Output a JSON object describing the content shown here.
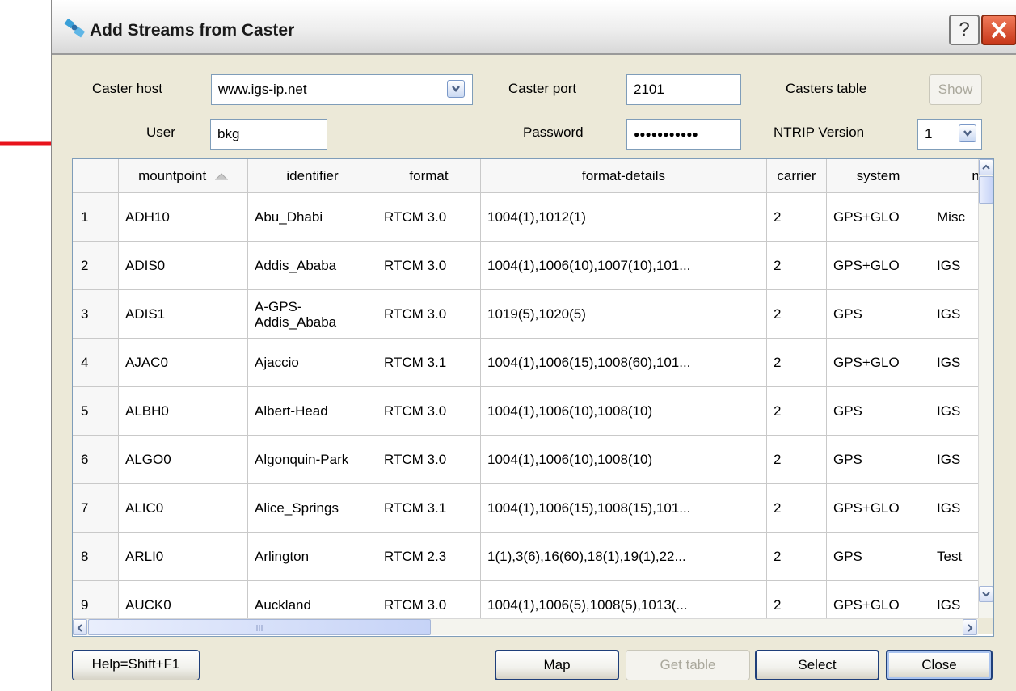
{
  "window": {
    "title": "Add Streams from Caster",
    "help_glyph": "?",
    "close_glyph": "✕"
  },
  "form": {
    "caster_host_label": "Caster host",
    "caster_host_value": "www.igs-ip.net",
    "caster_port_label": "Caster port",
    "caster_port_value": "2101",
    "casters_table_label": "Casters table",
    "show_label": "Show",
    "user_label": "User",
    "user_value": "bkg",
    "password_label": "Password",
    "password_value": "●●●●●●●●●●●",
    "ntrip_label": "NTRIP Version",
    "ntrip_value": "1"
  },
  "table": {
    "columns": [
      "",
      "mountpoint",
      "identifier",
      "format",
      "format-details",
      "carrier",
      "system",
      "net"
    ],
    "rows": [
      [
        "1",
        "ADH10",
        "Abu_Dhabi",
        "RTCM 3.0",
        "1004(1),1012(1)",
        "2",
        "GPS+GLO",
        "Misc"
      ],
      [
        "2",
        "ADIS0",
        "Addis_Ababa",
        "RTCM 3.0",
        "1004(1),1006(10),1007(10),101...",
        "2",
        "GPS+GLO",
        "IGS"
      ],
      [
        "3",
        "ADIS1",
        "A-GPS-Addis_Ababa",
        "RTCM 3.0",
        "1019(5),1020(5)",
        "2",
        "GPS",
        "IGS"
      ],
      [
        "4",
        "AJAC0",
        "Ajaccio",
        "RTCM 3.1",
        "1004(1),1006(15),1008(60),101...",
        "2",
        "GPS+GLO",
        "IGS"
      ],
      [
        "5",
        "ALBH0",
        "Albert-Head",
        "RTCM 3.0",
        "1004(1),1006(10),1008(10)",
        "2",
        "GPS",
        "IGS"
      ],
      [
        "6",
        "ALGO0",
        "Algonquin-Park",
        "RTCM 3.0",
        "1004(1),1006(10),1008(10)",
        "2",
        "GPS",
        "IGS"
      ],
      [
        "7",
        "ALIC0",
        "Alice_Springs",
        "RTCM 3.1",
        "1004(1),1006(15),1008(15),101...",
        "2",
        "GPS+GLO",
        "IGS"
      ],
      [
        "8",
        "ARLI0",
        "Arlington",
        "RTCM 2.3",
        "1(1),3(6),16(60),18(1),19(1),22...",
        "2",
        "GPS",
        "Test"
      ],
      [
        "9",
        "AUCK0",
        "Auckland",
        "RTCM 3.0",
        "1004(1),1006(5),1008(5),1013(...",
        "2",
        "GPS+GLO",
        "IGS"
      ]
    ]
  },
  "buttons": {
    "help": "Help=Shift+F1",
    "map": "Map",
    "get_table": "Get table",
    "select": "Select",
    "close": "Close"
  },
  "colors": {
    "arrow": "#e8121b",
    "close_button": "#d8482a"
  }
}
